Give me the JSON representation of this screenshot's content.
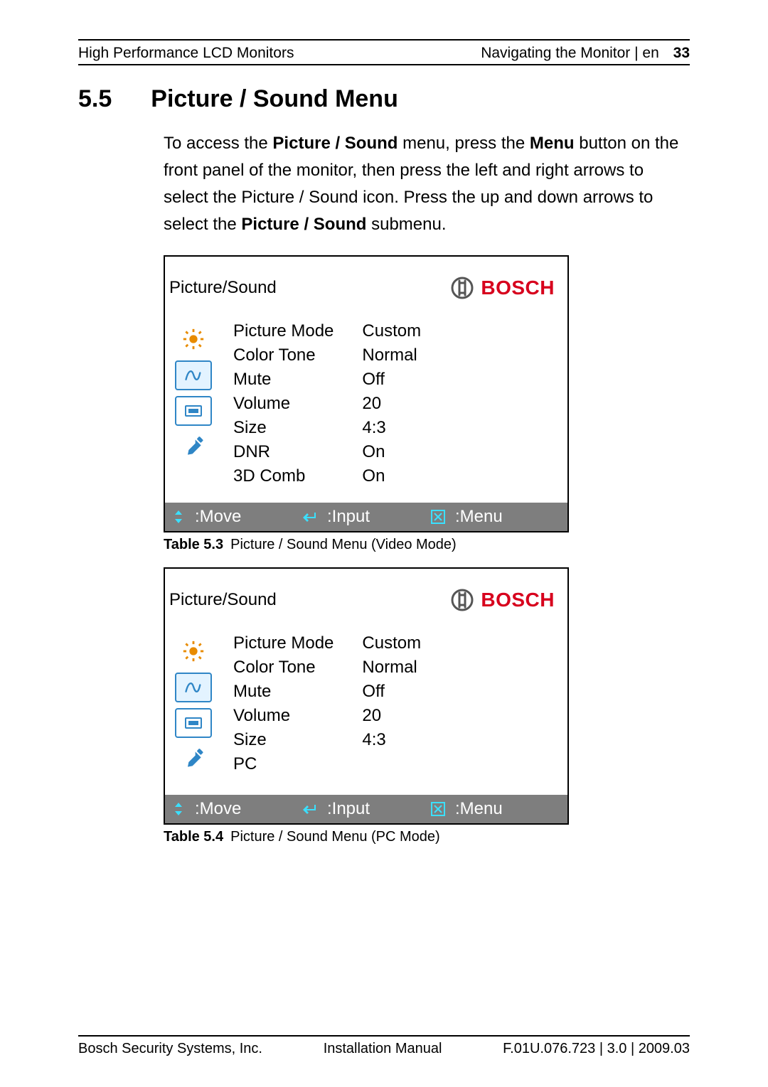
{
  "header": {
    "left": "High Performance LCD Monitors",
    "right_text": "Navigating the Monitor | en",
    "page_number": "33"
  },
  "section": {
    "number": "5.5",
    "title": "Picture / Sound Menu"
  },
  "intro": {
    "t1": "To access the ",
    "b1": "Picture / Sound",
    "t2": " menu, press the ",
    "b2": "Menu",
    "t3": " button on the front panel of the monitor, then press the left and right arrows to select the Picture / Sound icon. Press the up and down arrows to select the ",
    "b3": "Picture / Sound",
    "t4": " submenu."
  },
  "brand": "BOSCH",
  "osd1": {
    "title": "Picture/Sound",
    "items": [
      {
        "label": "Picture Mode",
        "value": "Custom"
      },
      {
        "label": "Color Tone",
        "value": "Normal"
      },
      {
        "label": "Mute",
        "value": "Off"
      },
      {
        "label": "Volume",
        "value": "20"
      },
      {
        "label": "Size",
        "value": "4:3"
      },
      {
        "label": "DNR",
        "value": "On"
      },
      {
        "label": "3D Comb",
        "value": "On"
      }
    ],
    "footer": {
      "move": ":Move",
      "input": ":Input",
      "menu": ":Menu"
    }
  },
  "caption1": {
    "label": "Table  5.3",
    "text": "Picture / Sound Menu (Video Mode)"
  },
  "osd2": {
    "title": "Picture/Sound",
    "items": [
      {
        "label": "Picture Mode",
        "value": "Custom"
      },
      {
        "label": "Color Tone",
        "value": "Normal"
      },
      {
        "label": "Mute",
        "value": "Off"
      },
      {
        "label": "Volume",
        "value": "20"
      },
      {
        "label": "Size",
        "value": "4:3"
      },
      {
        "label": "PC",
        "value": ""
      }
    ],
    "footer": {
      "move": ":Move",
      "input": ":Input",
      "menu": ":Menu"
    }
  },
  "caption2": {
    "label": "Table  5.4",
    "text": "Picture / Sound Menu (PC Mode)"
  },
  "footer": {
    "left": "Bosch Security Systems, Inc.",
    "center": "Installation Manual",
    "right": "F.01U.076.723 | 3.0 | 2009.03"
  }
}
